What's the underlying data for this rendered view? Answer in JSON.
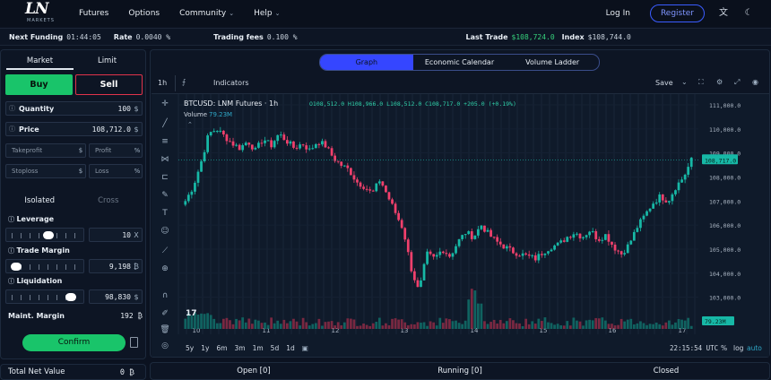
{
  "nav": {
    "logo_mark": "LN",
    "logo_sub": "MARKETS",
    "items": [
      "Futures",
      "Options",
      "Community",
      "Help"
    ],
    "login": "Log In",
    "register": "Register"
  },
  "infobar": {
    "next_funding_label": "Next Funding",
    "next_funding_value": "01:44:05",
    "rate_label": "Rate",
    "rate_value": "0.0040 %",
    "fees_label": "Trading fees",
    "fees_value": "0.100 %",
    "last_trade_label": "Last Trade",
    "last_trade_value": "$108,724.0",
    "index_label": "Index",
    "index_value": "$108,744.0"
  },
  "order": {
    "tabs": [
      "Market",
      "Limit"
    ],
    "buy": "Buy",
    "sell": "Sell",
    "quantity_label": "Quantity",
    "quantity_value": "100",
    "quantity_unit": "$",
    "price_label": "Price",
    "price_value": "108,712.0",
    "price_unit": "$",
    "takeprofit_ph": "Takeprofit",
    "takeprofit_unit": "$",
    "profit_ph": "Profit",
    "profit_unit": "%",
    "stoploss_ph": "Stoploss",
    "stoploss_unit": "$",
    "loss_ph": "Loss",
    "loss_unit": "%",
    "margin_tabs": [
      "Isolated",
      "Cross"
    ],
    "leverage_label": "Leverage",
    "leverage_value": "10",
    "leverage_unit": "X",
    "leverage_level": 0.55,
    "trade_margin_label": "Trade Margin",
    "trade_margin_value": "9,198",
    "trade_margin_unit": "₿",
    "trade_margin_level": 0.05,
    "liquidation_label": "Liquidation",
    "liquidation_value": "98,830",
    "liquidation_unit": "$",
    "liquidation_level": 0.9,
    "maint_label": "Maint. Margin",
    "maint_value": "192",
    "maint_unit": "₿",
    "confirm": "Confirm"
  },
  "total_net": {
    "label": "Total Net Value",
    "value": "0 ₿"
  },
  "chart_panel": {
    "view_tabs": [
      "Graph",
      "Economic Calendar",
      "Volume Ladder"
    ],
    "interval": "1h",
    "indicators": "Indicators",
    "save": "Save",
    "symbol": "BTCUSD: LNM Futures · 1h",
    "ohlc": "O108,512.0  H108,966.0  L108,512.0  C108,717.0  +205.0 (+0.19%)",
    "volume_label": "Volume",
    "volume_value": "79.23M",
    "ranges": [
      "5y",
      "1y",
      "6m",
      "3m",
      "1m",
      "5d",
      "1d"
    ],
    "clock": "22:15:54 UTC",
    "pct": "%",
    "log": "log",
    "auto": "auto"
  },
  "chart_data": {
    "type": "candlestick",
    "x_ticks": [
      "10",
      "11",
      "12",
      "13",
      "14",
      "15",
      "16",
      "17"
    ],
    "y_ticks": [
      "111,000.0",
      "110,000.0",
      "109,000.0",
      "108,000.0",
      "107,000.0",
      "106,000.0",
      "105,000.0",
      "104,000.0",
      "103,000.0"
    ],
    "ylim": [
      102500,
      111300
    ],
    "last_price_label": "108,717.0",
    "last_price": 108717,
    "volume_label": "79.23M",
    "close_path": [
      107000,
      107600,
      108600,
      109800,
      110000,
      109700,
      109400,
      109200,
      109500,
      109100,
      109600,
      109300,
      109800,
      109500,
      109200,
      109400,
      109100,
      109500,
      109300,
      108800,
      108500,
      108300,
      107800,
      107600,
      107300,
      107900,
      107200,
      106500,
      105800,
      104200,
      103200,
      104800,
      104600,
      105000,
      104700,
      105300,
      105700,
      105500,
      106000,
      105600,
      105300,
      105100,
      104900,
      104800,
      104700,
      104600,
      104900,
      105100,
      105200,
      105500,
      105700,
      105500,
      105800,
      105400,
      105600,
      105100,
      104800,
      105200,
      105900,
      106400,
      106900,
      107200,
      107000,
      107600,
      108000,
      108700
    ],
    "colors": {
      "up": "#17b8a6",
      "down": "#f0406c"
    }
  },
  "positions": {
    "tabs": [
      "Open [0]",
      "Running [0]",
      "Closed"
    ]
  }
}
